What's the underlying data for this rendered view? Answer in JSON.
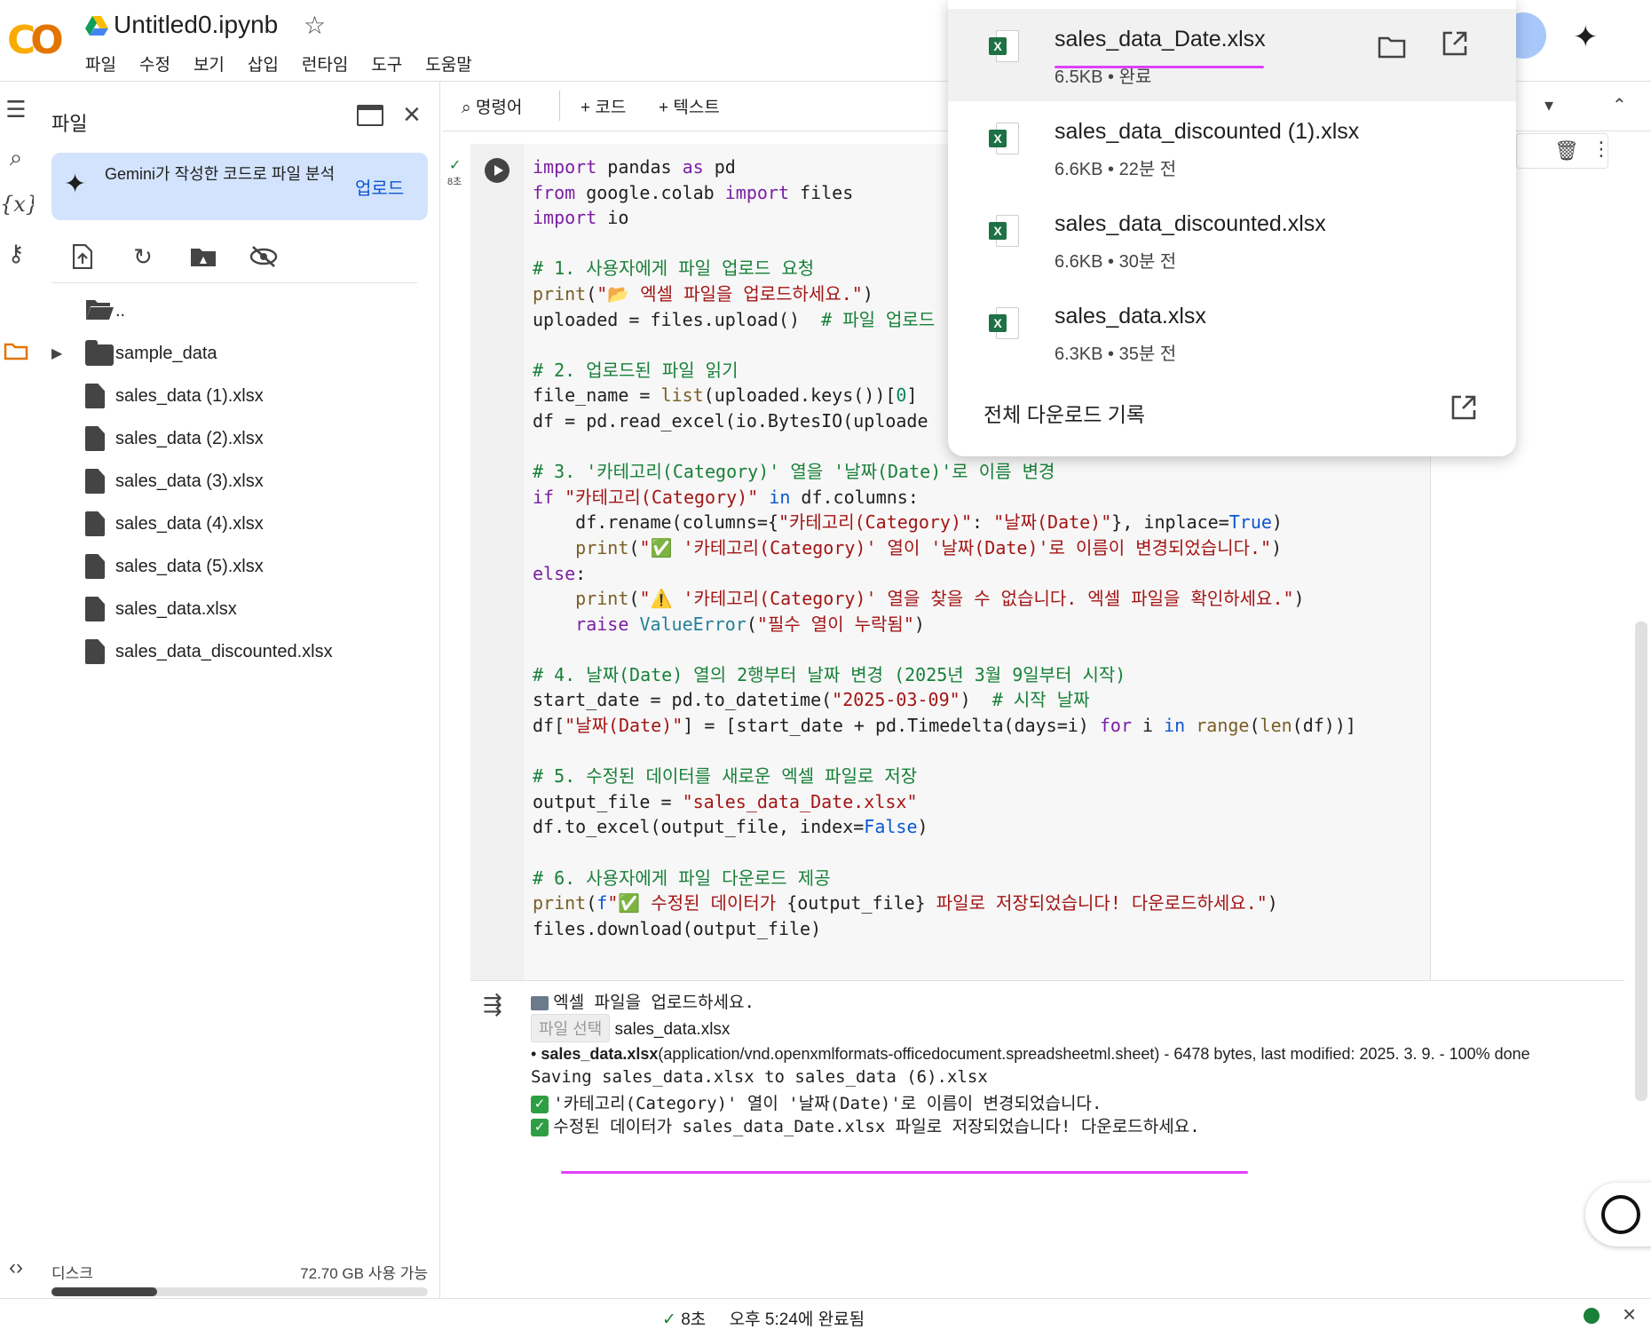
{
  "header": {
    "logo": "CO",
    "notebook_title": "Untitled0.ipynb",
    "menu": [
      "파일",
      "수정",
      "보기",
      "삽입",
      "런타임",
      "도구",
      "도움말"
    ]
  },
  "sidebar": {
    "title": "파일",
    "gemini_prompt": "Gemini가 작성한 코드로 파일 분석",
    "upload_label": "업로드",
    "tree": [
      {
        "type": "folder-open",
        "name": ".."
      },
      {
        "type": "folder",
        "name": "sample_data"
      },
      {
        "type": "file",
        "name": "sales_data (1).xlsx"
      },
      {
        "type": "file",
        "name": "sales_data (2).xlsx"
      },
      {
        "type": "file",
        "name": "sales_data (3).xlsx"
      },
      {
        "type": "file",
        "name": "sales_data (4).xlsx"
      },
      {
        "type": "file",
        "name": "sales_data (5).xlsx"
      },
      {
        "type": "file",
        "name": "sales_data.xlsx"
      },
      {
        "type": "file",
        "name": "sales_data_discounted.xlsx"
      }
    ],
    "disk_label": "디스크",
    "disk_available": "72.70 GB 사용 가능",
    "disk_used_fraction": 0.28
  },
  "toolbar": {
    "command": "명령어",
    "add_code": "+ 코드",
    "add_text": "+ 텍스트"
  },
  "cell": {
    "exec_time": "8초"
  },
  "output": {
    "line1": "엑셀 파일을 업로드하세요.",
    "choose_file": "파일 선택",
    "chosen": "sales_data.xlsx",
    "file_name": "sales_data.xlsx",
    "file_info": "(application/vnd.openxmlformats-officedocument.spreadsheetml.sheet) - 6478 bytes, last modified: 2025. 3. 9. - 100% done",
    "saving": "Saving sales_data.xlsx to sales_data (6).xlsx",
    "renamed": "'카테고리(Category)' 열이 '날짜(Date)'로 이름이 변경되었습니다.",
    "saved": "수정된 데이터가 sales_data_Date.xlsx 파일로 저장되었습니다! 다운로드하세요."
  },
  "downloads": {
    "items": [
      {
        "name": "sales_data_Date.xlsx",
        "meta": "6.5KB • 완료"
      },
      {
        "name": "sales_data_discounted (1).xlsx",
        "meta": "6.6KB • 22분 전"
      },
      {
        "name": "sales_data_discounted.xlsx",
        "meta": "6.6KB • 30분 전"
      },
      {
        "name": "sales_data.xlsx",
        "meta": "6.3KB • 35분 전"
      }
    ],
    "all_history": "전체 다운로드 기록"
  },
  "status": {
    "time": "8초",
    "completed": "오후 5:24에 완료됨"
  },
  "colors": {
    "accent": "#e37400",
    "highlight": "#e040fb",
    "link": "#0b57d0"
  }
}
